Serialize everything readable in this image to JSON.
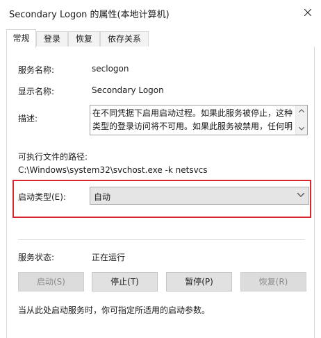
{
  "window": {
    "title": "Secondary Logon 的属性(本地计算机)"
  },
  "tabs": [
    {
      "label": "常规",
      "active": true
    },
    {
      "label": "登录",
      "active": false
    },
    {
      "label": "恢复",
      "active": false
    },
    {
      "label": "依存关系",
      "active": false
    }
  ],
  "general": {
    "service_name_label": "服务名称:",
    "service_name_value": "seclogon",
    "display_name_label": "显示名称:",
    "display_name_value": "Secondary Logon",
    "description_label": "描述:",
    "description_line1": "在不同凭据下启用启动过程。如果此服务被停止，这种",
    "description_line2": "类型的登录访问将不可用。如果此服务被禁用，任何明",
    "exe_path_label": "可执行文件的路径:",
    "exe_path_value": "C:\\Windows\\system32\\svchost.exe -k netsvcs",
    "startup_type_label": "启动类型(E):",
    "startup_type_value": "自动",
    "service_status_label": "服务状态:",
    "service_status_value": "正在运行",
    "note": "当从此处启动服务时，你可指定所适用的启动参数。"
  },
  "buttons": {
    "start": "启动(S)",
    "stop": "停止(T)",
    "pause": "暂停(P)",
    "resume": "恢复(R)"
  },
  "colors": {
    "highlight_border": "#d9252c",
    "combo_background": "#e5e5e5",
    "disabled_text": "#8a8a8a"
  },
  "icons": {
    "close": "close-icon",
    "dropdown": "chevron-down-icon",
    "scroll_up": "scroll-up-arrow-icon",
    "scroll_down": "scroll-down-arrow-icon"
  }
}
